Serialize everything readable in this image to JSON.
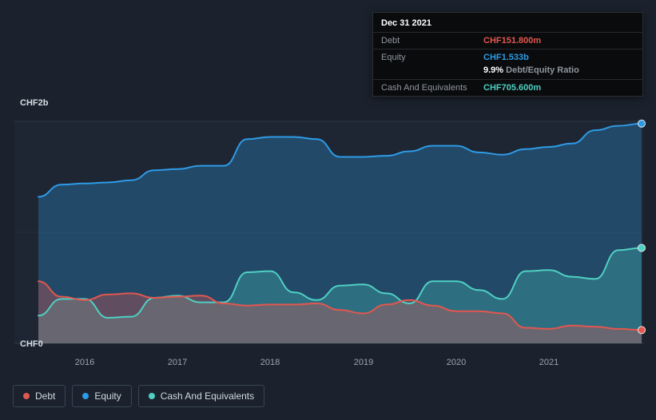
{
  "colors": {
    "debt": "#e2574f",
    "equity": "#2e9be6",
    "cash": "#4ed0c2",
    "background": "#1b222d",
    "grid": "#2e3947",
    "tooltip_bg": "#0a0b0d"
  },
  "tooltip": {
    "date": "Dec 31 2021",
    "debt": {
      "label": "Debt",
      "value": "CHF151.800m"
    },
    "equity": {
      "label": "Equity",
      "value": "CHF1.533b"
    },
    "ratio": {
      "pct": "9.9%",
      "text": " Debt/Equity Ratio"
    },
    "cash": {
      "label": "Cash And Equivalents",
      "value": "CHF705.600m"
    }
  },
  "axis": {
    "y_top": "CHF2b",
    "y_bottom": "CHF0",
    "x_ticks": [
      "2016",
      "2017",
      "2018",
      "2019",
      "2020",
      "2021"
    ]
  },
  "legend": [
    {
      "label": "Debt",
      "color": "#e2574f"
    },
    {
      "label": "Equity",
      "color": "#2e9be6"
    },
    {
      "label": "Cash And Equivalents",
      "color": "#4ed0c2"
    }
  ],
  "chart_data": {
    "type": "area",
    "title": "",
    "xlabel": "",
    "ylabel": "CHF",
    "xlim": [
      2015.5,
      2022.0
    ],
    "ylim": [
      0,
      2
    ],
    "grid": "horizontal",
    "legend_position": "bottom-left",
    "x": [
      2015.5,
      2015.75,
      2016.0,
      2016.25,
      2016.5,
      2016.75,
      2017.0,
      2017.25,
      2017.5,
      2017.75,
      2018.0,
      2018.25,
      2018.5,
      2018.75,
      2019.0,
      2019.25,
      2019.5,
      2019.75,
      2020.0,
      2020.25,
      2020.5,
      2020.75,
      2021.0,
      2021.25,
      2021.5,
      2021.75,
      2022.0
    ],
    "series": [
      {
        "name": "Equity",
        "color": "#2e9be6",
        "fill_opacity": 0.3,
        "values": [
          1.32,
          1.43,
          1.44,
          1.45,
          1.47,
          1.56,
          1.57,
          1.6,
          1.6,
          1.84,
          1.86,
          1.86,
          1.84,
          1.68,
          1.68,
          1.69,
          1.73,
          1.78,
          1.78,
          1.72,
          1.7,
          1.75,
          1.77,
          1.8,
          1.92,
          1.96,
          1.98
        ]
      },
      {
        "name": "Cash And Equivalents",
        "color": "#4ed0c2",
        "fill_opacity": 0.28,
        "values": [
          0.25,
          0.4,
          0.4,
          0.23,
          0.24,
          0.41,
          0.43,
          0.37,
          0.37,
          0.64,
          0.65,
          0.46,
          0.39,
          0.52,
          0.53,
          0.45,
          0.36,
          0.56,
          0.56,
          0.48,
          0.4,
          0.65,
          0.66,
          0.6,
          0.58,
          0.84,
          0.86
        ]
      },
      {
        "name": "Debt",
        "color": "#e2574f",
        "fill_opacity": 0.32,
        "values": [
          0.56,
          0.42,
          0.39,
          0.44,
          0.45,
          0.41,
          0.42,
          0.43,
          0.36,
          0.34,
          0.35,
          0.35,
          0.36,
          0.3,
          0.27,
          0.35,
          0.39,
          0.34,
          0.29,
          0.29,
          0.27,
          0.14,
          0.13,
          0.16,
          0.15,
          0.13,
          0.12
        ]
      }
    ],
    "final_values": {
      "Debt": 0.1518,
      "Equity": 1.533,
      "Cash And Equivalents": 0.7056
    }
  }
}
